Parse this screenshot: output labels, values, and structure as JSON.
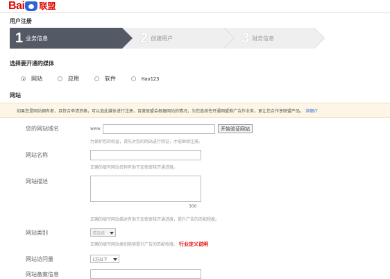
{
  "logo": {
    "bai": "Bai",
    "union": "联盟"
  },
  "page": {
    "title": "用户注册"
  },
  "steps": [
    {
      "num": "1",
      "label": "业务信息"
    },
    {
      "num": "2",
      "label": "创建用户"
    },
    {
      "num": "3",
      "label": "财务信息"
    }
  ],
  "media": {
    "title": "选择要开通的媒体",
    "options": [
      {
        "label": "网站",
        "selected": true
      },
      {
        "label": "应用",
        "selected": false
      },
      {
        "label": "软件",
        "selected": false
      },
      {
        "label": "Hao123",
        "selected": false
      }
    ]
  },
  "section": {
    "title": "网站"
  },
  "notice": {
    "text": "如果您是网站拥有者，且符合申请资格，可以选此媒体进行注册，百度联盟会根据网站的情况，为您选择性开通网盟推广合作业务，更让您合作享联盟产品。",
    "link": "详细介"
  },
  "form": {
    "domain": {
      "label": "您的网站域名",
      "prefix": "www",
      "button": "开始验证网站",
      "hint": "为保护您的权益，请先对您的网站进行验证，才能继续注册。"
    },
    "site_name": {
      "label": "网站名称",
      "hint": "正确的填写网站名称有助于加快审核开通进度。"
    },
    "site_desc": {
      "label": "网站描述",
      "counter": "300",
      "hint": "正确的填写网站描述有助于加快审核开通进度，提升广告的匹配程度。"
    },
    "site_category": {
      "label": "网站类别",
      "select_value": "请选择",
      "hint": "正确的填写网站类别能够提升广告的匹配程度。",
      "hint_link": "行业定义说明"
    },
    "site_traffic": {
      "label": "网站访问量",
      "select_value": "1万以下"
    },
    "site_icp": {
      "label": "网站备案信息"
    }
  }
}
